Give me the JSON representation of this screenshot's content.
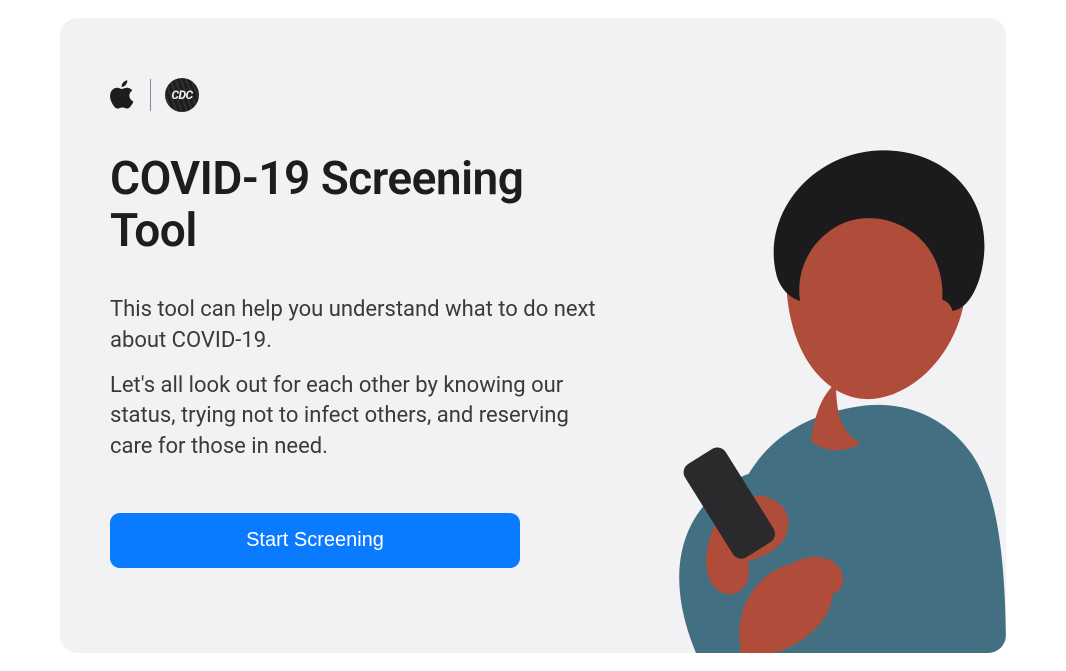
{
  "header": {
    "apple_icon_name": "apple-logo-icon",
    "cdc_icon_name": "cdc-logo-icon",
    "cdc_text": "CDC"
  },
  "main": {
    "title": "COVID‑19 Screening Tool",
    "paragraph1": "This tool can help you understand what to do next about COVID‑19.",
    "paragraph2": "Let's all look out for each other by knowing our status, trying not to infect others, and reserving care for those in need."
  },
  "cta": {
    "start_label": "Start Screening"
  },
  "colors": {
    "card_bg": "#f2f2f4",
    "text_primary": "#1d1d1f",
    "text_body": "#3a3a3c",
    "button_bg": "#0a7aff",
    "button_text": "#ffffff",
    "illustration_skin": "#b04d3a",
    "illustration_shirt": "#436f82",
    "illustration_hair": "#1b1b1d",
    "illustration_phone": "#2a2a2c"
  }
}
